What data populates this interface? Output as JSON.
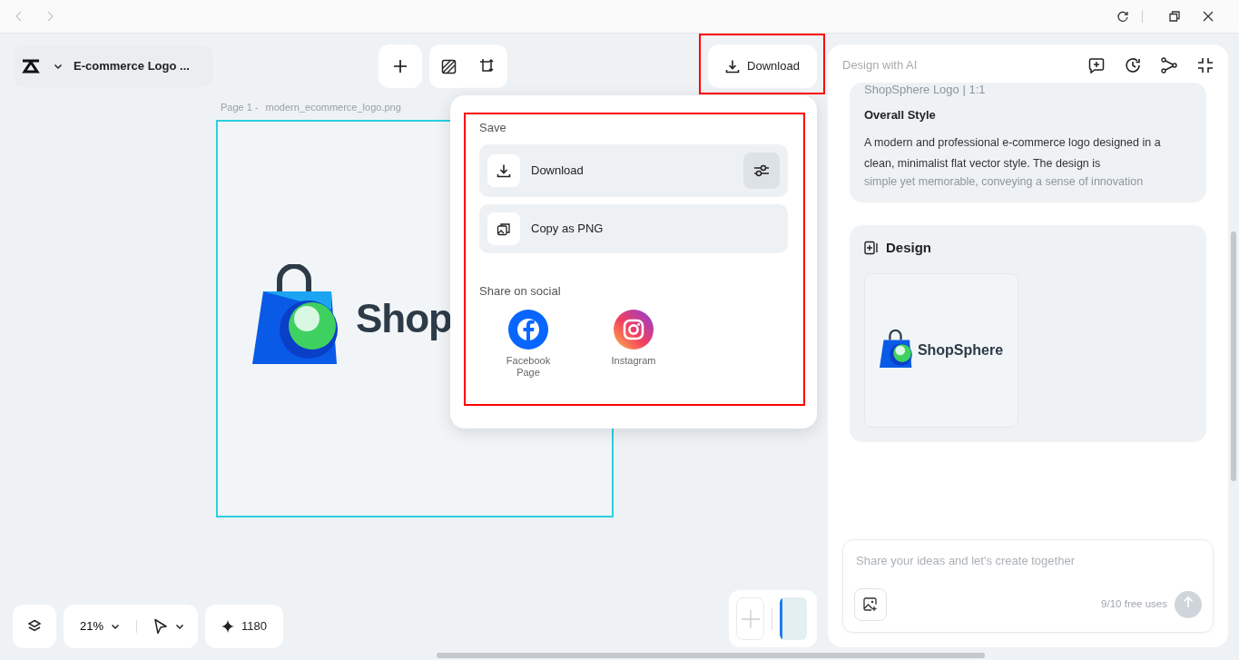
{
  "document": {
    "title": "E-commerce Logo ..."
  },
  "download_button": {
    "label": "Download",
    "highlighted": true
  },
  "page": {
    "label": "Page 1 -",
    "filename": "modern_ecommerce_logo.png",
    "logo_text": "Shop",
    "selected": true
  },
  "download_menu": {
    "highlighted": true,
    "save_title": "Save",
    "save_options": [
      {
        "kind": "download",
        "label": "Download",
        "has_settings": true
      },
      {
        "kind": "copy",
        "label": "Copy as PNG",
        "has_settings": false
      }
    ],
    "share_title": "Share on social",
    "share_targets": [
      {
        "kind": "facebook",
        "label": "Facebook Page"
      },
      {
        "kind": "instagram",
        "label": "Instagram"
      }
    ]
  },
  "ai_panel": {
    "title": "Design with AI",
    "prompt_card": {
      "title": "ShopSphere Logo | 1:1",
      "heading": "Overall Style",
      "text": "A modern and professional e-commerce logo designed in a clean, minimalist flat vector style. The design is",
      "faded_text": "simple yet memorable, conveying a sense of innovation"
    },
    "design_card": {
      "title": "Design",
      "thumbnail_text": "ShopSphere"
    },
    "chat": {
      "placeholder": "Share your ideas and let's create together",
      "usage": "9/10 free uses",
      "send_disabled": true
    }
  },
  "bottom_bar": {
    "zoom": "21%",
    "credits": "1180"
  }
}
